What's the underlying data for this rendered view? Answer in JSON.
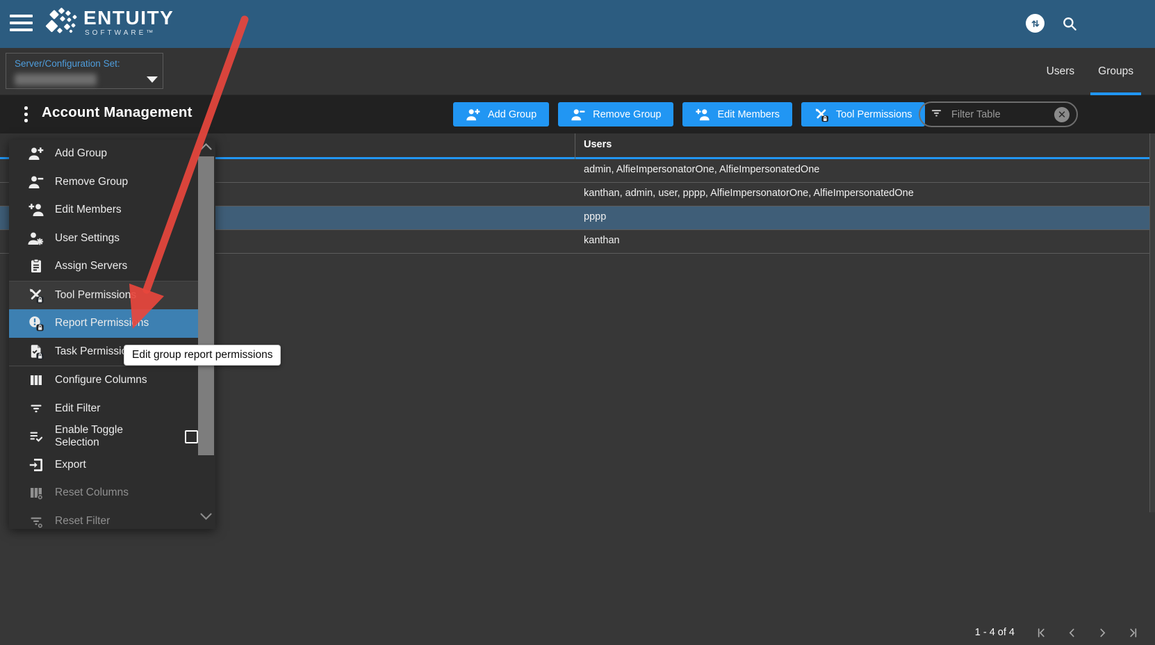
{
  "topbar": {
    "brand": "ENTUITY",
    "brand_sub": "SOFTWARE™",
    "icons": [
      "hamburger-menu-icon",
      "data-transfer-icon",
      "search-icon"
    ]
  },
  "subbar": {
    "server_label": "Server/Configuration Set:",
    "server_value_redacted": true,
    "tabs": [
      {
        "label": "Users",
        "active": false
      },
      {
        "label": "Groups",
        "active": true
      }
    ]
  },
  "header": {
    "title": "Account Management",
    "buttons": [
      {
        "label": "Add Group",
        "icon": "person-add"
      },
      {
        "label": "Remove Group",
        "icon": "person-remove"
      },
      {
        "label": "Edit Members",
        "icon": "member-add"
      },
      {
        "label": "Tool Permissions",
        "icon": "tool-permissions"
      }
    ],
    "filter_placeholder": "Filter Table"
  },
  "menu": {
    "items": [
      {
        "label": "Add Group",
        "icon": "person-add"
      },
      {
        "label": "Remove Group",
        "icon": "person-remove"
      },
      {
        "label": "Edit Members",
        "icon": "member-add"
      },
      {
        "label": "User Settings",
        "icon": "user-settings"
      },
      {
        "label": "Assign Servers",
        "icon": "assign-servers",
        "divider_after": true
      },
      {
        "label": "Tool Permissions",
        "icon": "tool-permissions",
        "hovered": true
      },
      {
        "label": "Report Permissions",
        "icon": "report-permissions",
        "selected": true
      },
      {
        "label": "Task Permissions",
        "icon": "task-permissions",
        "divider_after": true
      },
      {
        "label": "Configure Columns",
        "icon": "configure-columns"
      },
      {
        "label": "Edit Filter",
        "icon": "edit-filter"
      },
      {
        "label": "Enable Toggle Selection",
        "icon": "toggle-selection",
        "checkbox": true,
        "checkbox_checked": false
      },
      {
        "label": "Export",
        "icon": "export"
      },
      {
        "label": "Reset Columns",
        "icon": "reset-columns",
        "disabled": true
      },
      {
        "label": "Reset Filter",
        "icon": "reset-filter",
        "disabled": true
      }
    ]
  },
  "tooltip": {
    "text": "Edit group report permissions"
  },
  "table": {
    "columns": [
      {
        "label": ""
      },
      {
        "label": "Users"
      }
    ],
    "rows": [
      {
        "users": "admin, AlfieImpersonatorOne, AlfieImpersonatedOne",
        "selected": false
      },
      {
        "users": "kanthan, admin, user, pppp, AlfieImpersonatorOne, AlfieImpersonatedOne",
        "selected": false
      },
      {
        "users": "pppp",
        "selected": true
      },
      {
        "users": "kanthan",
        "selected": false
      }
    ]
  },
  "pagination": {
    "range_label": "1 - 4 of 4",
    "buttons": [
      "first-page",
      "previous-page",
      "next-page",
      "last-page"
    ]
  },
  "colors": {
    "accent": "#2196f3",
    "topbar": "#2c5c80",
    "subbar": "#343434",
    "toolbar_strip": "#212121",
    "table_header": "#333333",
    "row_bg": "#373737",
    "row_selected": "#3f5e78",
    "menu_bg": "#2d2d2d",
    "menu_hover": "#3a3a3a",
    "menu_selected": "#3d80b2",
    "label_blue": "#4e9ddc",
    "arrow_red": "#e8463d"
  }
}
